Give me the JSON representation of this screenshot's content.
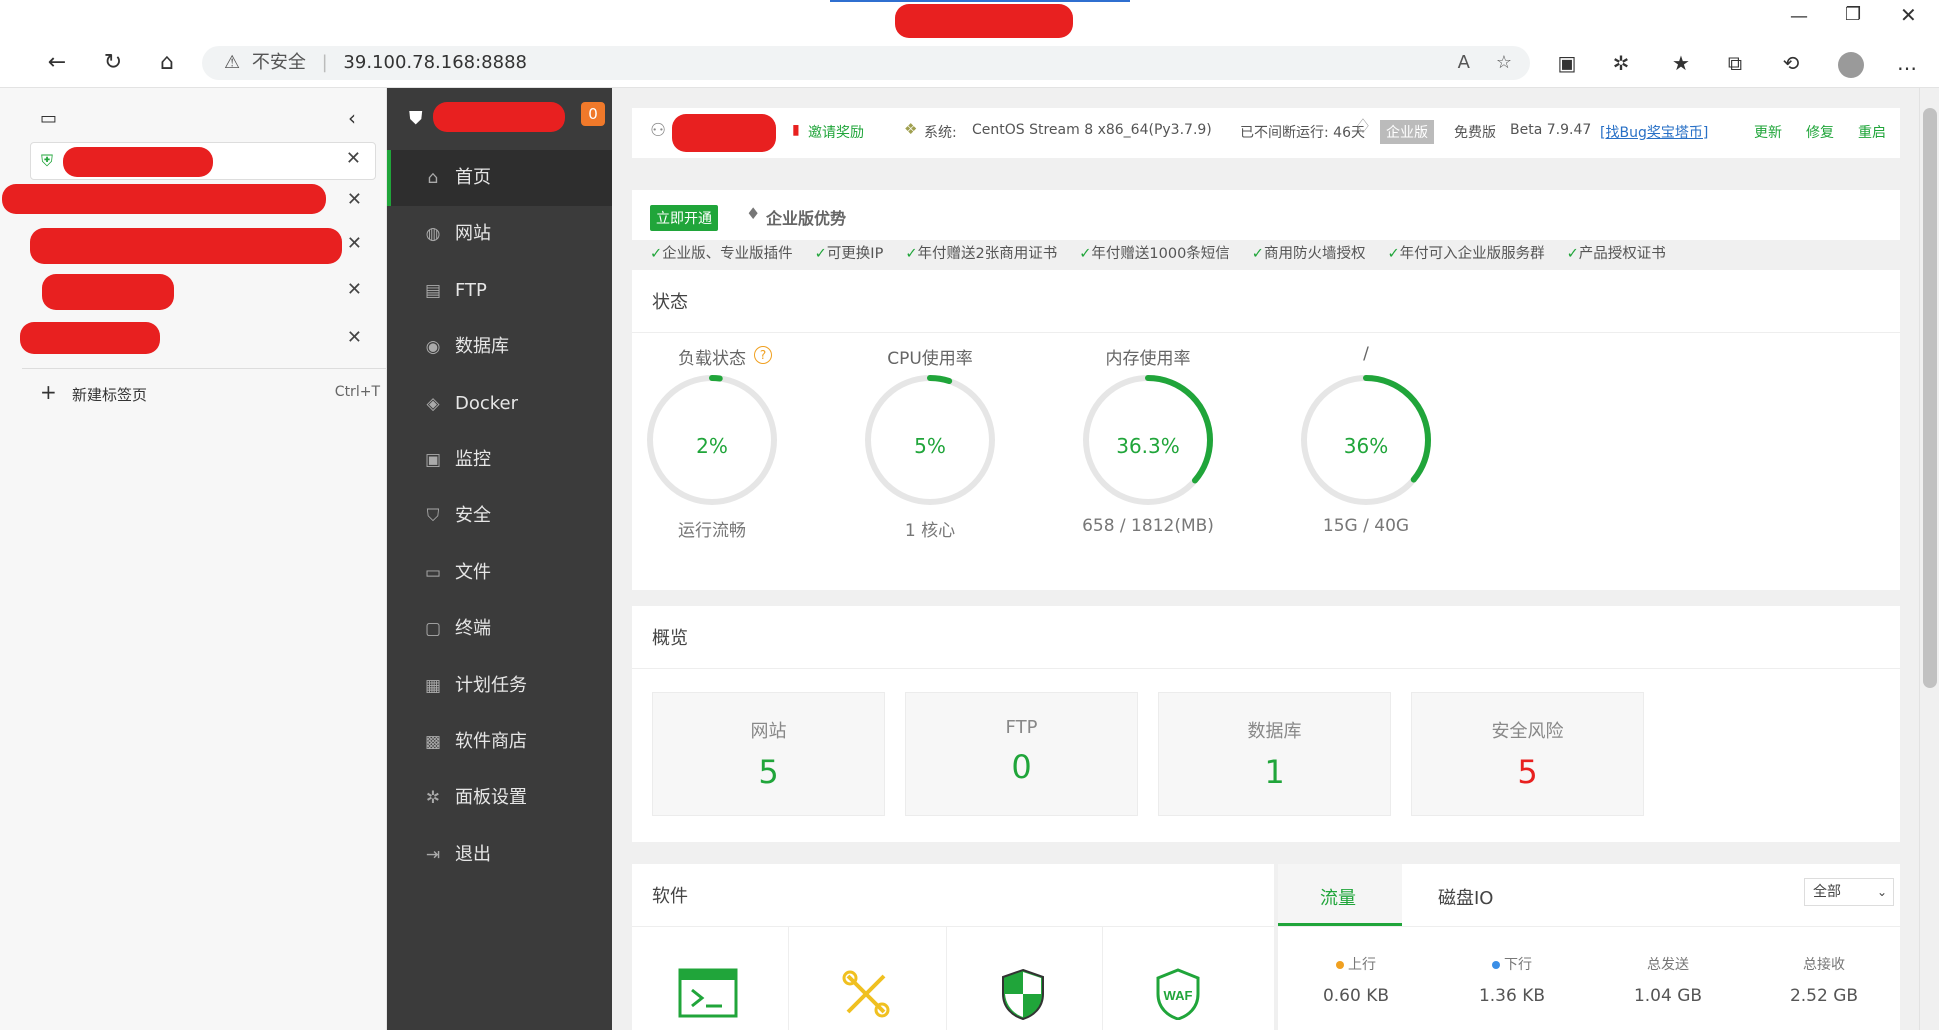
{
  "browser": {
    "address_security": "不安全",
    "url": "39.100.78.168:8888",
    "new_tab": "新建标签页",
    "new_tab_shortcut": "Ctrl+T"
  },
  "panel": {
    "badge": "0",
    "menu": [
      "首页",
      "网站",
      "FTP",
      "数据库",
      "Docker",
      "监控",
      "安全",
      "文件",
      "终端",
      "计划任务",
      "软件商店",
      "面板设置",
      "退出"
    ]
  },
  "header": {
    "invite": "邀请奖励",
    "system_label": "系统:",
    "system_value": "CentOS Stream 8 x86_64(Py3.7.9)",
    "uptime": "已不间断运行: 46天",
    "enterprise": "企业版",
    "free": "免费版",
    "version": "Beta 7.9.47",
    "bug": "[找Bug奖宝塔币]",
    "update": "更新",
    "repair": "修复",
    "restart": "重启"
  },
  "promo": {
    "open_button": "立即开通",
    "title": "企业版优势",
    "items": [
      "企业版、专业版插件",
      "可更换IP",
      "年付赠送2张商用证书",
      "年付赠送1000条短信",
      "商用防火墙授权",
      "年付可入企业版服务群",
      "产品授权证书"
    ]
  },
  "status": {
    "title": "状态",
    "gauges": [
      {
        "label": "负载状态",
        "value": "2%",
        "sub": "运行流畅",
        "pct": 2
      },
      {
        "label": "CPU使用率",
        "value": "5%",
        "sub": "1 核心",
        "pct": 5
      },
      {
        "label": "内存使用率",
        "value": "36.3%",
        "sub": "658 / 1812(MB)",
        "pct": 36.3
      },
      {
        "label": "/",
        "value": "36%",
        "sub": "15G / 40G",
        "pct": 36
      }
    ]
  },
  "overview": {
    "title": "概览",
    "items": [
      {
        "label": "网站",
        "value": "5"
      },
      {
        "label": "FTP",
        "value": "0"
      },
      {
        "label": "数据库",
        "value": "1"
      },
      {
        "label": "安全风险",
        "value": "5"
      }
    ]
  },
  "software": {
    "title": "软件"
  },
  "traffic": {
    "tabs": [
      "流量",
      "磁盘IO"
    ],
    "select": "全部",
    "stats": [
      {
        "label": "上行",
        "value": "0.60 KB"
      },
      {
        "label": "下行",
        "value": "1.36 KB"
      },
      {
        "label": "总发送",
        "value": "1.04 GB"
      },
      {
        "label": "总接收",
        "value": "2.52 GB"
      }
    ]
  },
  "colors": {
    "accent": "#20a53a",
    "danger": "#e8201f",
    "sidebar": "#3b3b3b"
  }
}
